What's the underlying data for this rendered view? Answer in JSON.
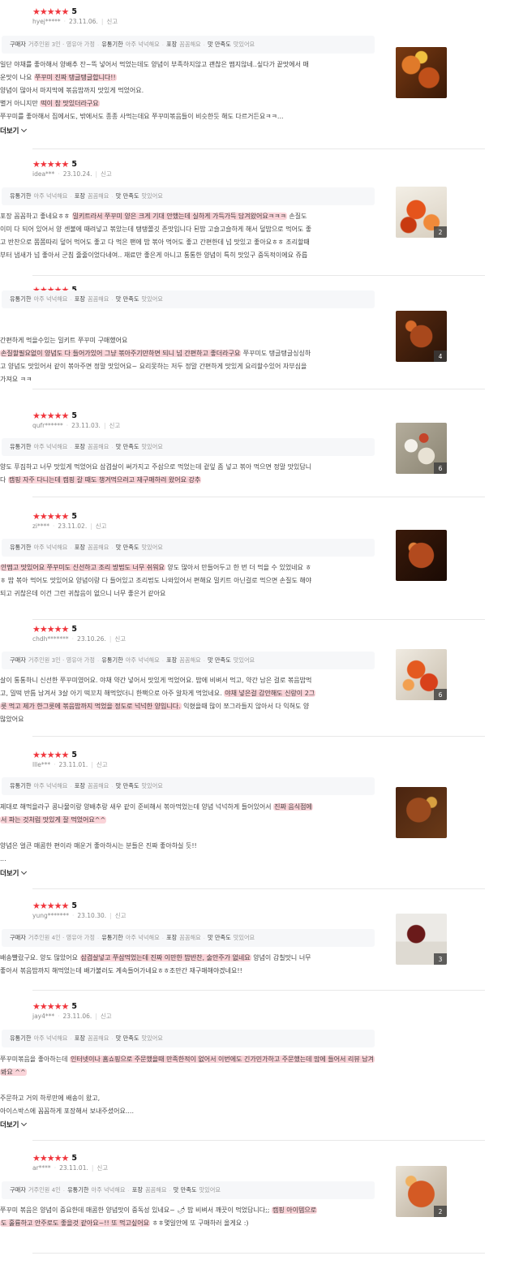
{
  "star_color": "#f0363d",
  "highlight_color": "#fad4d9",
  "star_glyphs": "★★★★★",
  "reviews": [
    {
      "score": "5",
      "user": "hyej*****",
      "date": "23.11.06.",
      "report": "신고",
      "attrs": [
        [
          "구매자",
          "거주인원 3인 · 영유아 가정"
        ],
        [
          "유통기한",
          "아주 넉넉해요"
        ],
        [
          "포장",
          "꼼꼼해요"
        ],
        [
          "맛 만족도",
          "맛있어요"
        ]
      ],
      "lines": [
        [
          [
            "일단 야채를 좋아해서 양배추 잔~뜩 넣어서 먹었는데도 양념이 부족하지않고 괜찮은 맵지않네..싶다가 끝맛에서 매",
            0
          ]
        ],
        [
          [
            "운맛이 나요 ",
            0
          ],
          [
            "쭈꾸미 진짜 탱글탱글합니다!!",
            1
          ]
        ],
        [
          [
            "양념이 많아서 마지막에 볶음밥까지 맛있게 먹었어요.",
            0
          ]
        ],
        [
          [
            "별거 아니지만 ",
            0
          ],
          [
            "떡이 참 맛있더라구요",
            1
          ]
        ],
        [
          [
            "쭈꾸미를 좋아해서 집에서도, 밖에서도 종종 사먹는데요 쭈꾸미볶음들이 비슷한듯 해도 다르거든요ㅋㅋ...",
            0
          ]
        ]
      ],
      "more": "더보기",
      "photo_count": ""
    },
    {
      "score": "5",
      "user": "idea***",
      "date": "23.10.24.",
      "report": "신고",
      "attrs": [
        [
          "유통기한",
          "아주 넉넉해요"
        ],
        [
          "포장",
          "꼼꼼해요"
        ],
        [
          "맛 만족도",
          "맛있어요"
        ]
      ],
      "lines": [
        [
          [
            "포장 꼼꼼하고 좋네요ㅎㅎ ",
            0
          ],
          [
            "밀키트라서 쭈꾸미 양은 크게 기대 안했는데 실하게 가득가득 담겨왔어요ㅋㅋㅋ",
            1
          ],
          [
            " 손질도",
            0
          ]
        ],
        [
          [
            "이미 다 되어 있어서 양 센불에 때려넣고 볶았는데 탱탱쫄깃 존맛입니다 된밥 고슬고슬하게 해서 덮밥으로 먹어도 좋",
            0
          ]
        ],
        [
          [
            "고 반찬으로 쫌쫌따리 덮어 먹어도 좋고 다 먹은 팬에 밥 볶아 먹어도 좋고 간편한데 넘 맛있고 좋아요ㅎㅎ 조리할때",
            0
          ]
        ],
        [
          [
            "부터 냄새가 넘 좋아서 군침 줄줄이었다네여.. 재료만 좋은게 아니고 통통한 양념이 특히 맛있구 중독적이에요 쥬릅",
            0
          ]
        ]
      ],
      "more": "",
      "photo_count": "2"
    },
    {
      "score": "5",
      "user": "sunj*****",
      "date": "23.10.30.",
      "report": "신고",
      "attrs": [
        [
          "유통기한",
          "아주 넉넉해요"
        ],
        [
          "포장",
          "꼼꼼해요"
        ],
        [
          "맛 만족도",
          "맛있어요"
        ]
      ],
      "lines": [
        [
          [
            "간편하게 먹을수있는 밀키트 쭈꾸미 구매했어요",
            0
          ]
        ],
        [
          [
            "손질할필요없이 양념도 다 들어가있어 그냥 볶아주기만하면 되니 넘 간편하고 좋더라구요",
            1
          ],
          [
            " 쭈꾸미도 탱글탱글싱싱하",
            0
          ]
        ],
        [
          [
            "고 양념도 맛있어서 같이 볶아주면 정말 맛있어요~ 요리못하는 저두 정말 간편하게 맛있게 요리할수있어 자부심을",
            0
          ]
        ],
        [
          [
            "가져요 ㅋㅋ",
            0
          ]
        ]
      ],
      "more": "",
      "photo_count": "4"
    },
    {
      "score": "5",
      "user": "qufr******",
      "date": "23.11.03.",
      "report": "신고",
      "attrs": [
        [
          "유통기한",
          "아주 넉넉해요"
        ],
        [
          "포장",
          "꼼꼼해요"
        ],
        [
          "맛 만족도",
          "맛있어요"
        ]
      ],
      "lines": [
        [
          [
            "양도 푸짐하고 너무 맛있게 먹었어요 삼겹살이 써가지고 주삼으로 먹었는데 겉잎 좀 넣고 볶아 먹으면 정말 맛있답니",
            0
          ]
        ],
        [
          [
            "다 ",
            0
          ],
          [
            "캠핑 자주 다니는데 캠핑 갈 때도 챙겨먹으려고 재구매하려 왔어요 강추",
            1
          ]
        ]
      ],
      "more": "",
      "photo_count": "6"
    },
    {
      "score": "5",
      "user": "zi****",
      "date": "23.11.02.",
      "report": "신고",
      "attrs": [
        [
          "유통기한",
          "아주 넉넉해요"
        ],
        [
          "포장",
          "꼼꼼해요"
        ],
        [
          "맛 만족도",
          "맛있어요"
        ]
      ],
      "lines": [
        [
          [
            "안맵고 맛있어요 쭈꾸미도 신선하고 조리 방법도 너무 쉬워요",
            1
          ],
          [
            " 양도 많아서 만들어두고 한 번 더 먹을 수 있었네요 ㅎ",
            0
          ]
        ],
        [
          [
            "ㅎ 밥 볶아 먹어도 맛있어요 양념이랑 다 들어있고 조리법도 나와있어서 편해요 밀키트 아닌걸로 먹으면 손질도 해야",
            0
          ]
        ],
        [
          [
            "되고 귀찮은데 이건 그런 귀찮음이 없으니 너무 좋은거 같아요",
            0
          ]
        ]
      ],
      "more": "",
      "photo_count": ""
    },
    {
      "score": "5",
      "user": "chdh*******",
      "date": "23.10.26.",
      "report": "신고",
      "attrs": [
        [
          "구매자",
          "거주인원 3인 · 영유아 가정"
        ],
        [
          "유통기한",
          "아주 넉넉해요"
        ],
        [
          "포장",
          "꼼꼼해요"
        ],
        [
          "맛 만족도",
          "맛있어요"
        ]
      ],
      "lines": [
        [
          [
            "살이 통통하니 신선한 쭈꾸미였어요. 야채 약간 넣어서 맛있게 먹었어요.  밥에 비벼서 먹고, 약간 남은 걸로 볶음밥먹",
            0
          ]
        ],
        [
          [
            "고, 밀떡 반틈 남겨서 3살 아기 떡꼬치 해먹었더니 한팩으로 아주 알차게 먹었네요. ",
            0
          ],
          [
            "야채 넣은걸 감안해도 신랑이 2그",
            1
          ]
        ],
        [
          [
            "릇 먹고 제가 한그릇에 볶음밥까지 먹었을 정도로 넉넉한 양입니다.",
            1
          ],
          [
            " 익혔을때 많이 쪼그라들지 않아서 다 익혀도 양",
            0
          ]
        ],
        [
          [
            "많았어요",
            0
          ]
        ]
      ],
      "more": "",
      "photo_count": "6"
    },
    {
      "score": "5",
      "user": "llle***",
      "date": "23.11.01.",
      "report": "신고",
      "attrs": [
        [
          "유통기한",
          "아주 넉넉해요"
        ],
        [
          "포장",
          "꼼꼼해요"
        ],
        [
          "맛 만족도",
          "맛있어요"
        ]
      ],
      "lines": [
        [
          [
            "제대로 해먹을라구 콩나물이랑 양배추랑 새우 같이 준비해서 볶아먹었는데 양념 넉넉하게 들어있어서 ",
            0
          ],
          [
            "진짜 음식점에",
            1
          ]
        ],
        [
          [
            "서 파는 것처럼 맛있게 잘 먹었어요^^",
            1
          ]
        ],
        [
          [
            "",
            0
          ]
        ],
        [
          [
            "양념은 얼큰 매콤한 편이라 매운거 좋아하시는 분들은 진짜 좋아하실 듯!!",
            0
          ]
        ],
        [
          [
            "...",
            0
          ]
        ]
      ],
      "more": "더보기",
      "photo_count": ""
    },
    {
      "score": "5",
      "user": "yung*******",
      "date": "23.10.30.",
      "report": "신고",
      "attrs": [
        [
          "구매자",
          "거주인원 4인 · 영유아 가정"
        ],
        [
          "유통기한",
          "아주 넉넉해요"
        ],
        [
          "포장",
          "꼼꼼해요"
        ],
        [
          "맛 만족도",
          "맛있어요"
        ]
      ],
      "lines": [
        [
          [
            "배송빨랐구요. 양도 많았어요 ",
            0
          ],
          [
            "삼겹살넣고 쭈삼먹었는데 진짜 이만한 밥반찬, 술안주가 없네요",
            1
          ],
          [
            " 양념이 감칠맛니 너무",
            0
          ]
        ],
        [
          [
            "좋아서 볶음밥까지 해먹었는데 배가불러도 계속들어가네요ㅎㅎ조만간 재구매해야겠네요!!",
            0
          ]
        ]
      ],
      "more": "",
      "photo_count": "3"
    },
    {
      "score": "5",
      "user": "jay4***",
      "date": "23.11.06.",
      "report": "신고",
      "attrs": [
        [
          "유통기한",
          "아주 넉넉해요"
        ],
        [
          "포장",
          "꼼꼼해요"
        ],
        [
          "맛 만족도",
          "맛있어요"
        ]
      ],
      "lines": [
        [
          [
            "쭈꾸미볶음을 좋아하는데 ",
            0
          ],
          [
            "인터넷이나 홈쇼핑으로 주문했을때 만족한적이 없어서 이번에도 긴가민가하고 주문했는데 맘에 들어서 리뷰 남겨",
            1
          ]
        ],
        [
          [
            "봐요 ^^",
            1
          ]
        ],
        [
          [
            "",
            0
          ]
        ],
        [
          [
            "주문하고 거의 하루만에 배송이 왔고,",
            0
          ]
        ],
        [
          [
            "아이스박스에 꼼꼼하게 포장해서 보내주셨어요....",
            0
          ]
        ]
      ],
      "more": "더보기",
      "photo_count": ""
    },
    {
      "score": "5",
      "user": "ar****",
      "date": "23.11.01.",
      "report": "신고",
      "attrs": [
        [
          "구매자",
          "거주인원 4인"
        ],
        [
          "유통기한",
          "아주 넉넉해요"
        ],
        [
          "포장",
          "꼼꼼해요"
        ],
        [
          "맛 만족도",
          "맛있어요"
        ]
      ],
      "lines": [
        [
          [
            "쭈꾸미 볶음은 양념이 중요한데 매콤한 양념맛이 중독성 있네요~ 🌶 밥 비벼서 깨끗이 먹었답니다;; ",
            0
          ],
          [
            "캠핑 아이템으로",
            1
          ]
        ],
        [
          [
            "도 훌륭하고 안주로도 좋을것 같아요~!! 또 먹고싶어요",
            1
          ],
          [
            " ㅎㅎ몇일안에 또 구매하러 올게요 :)",
            0
          ]
        ]
      ],
      "more": "",
      "photo_count": "2"
    }
  ]
}
